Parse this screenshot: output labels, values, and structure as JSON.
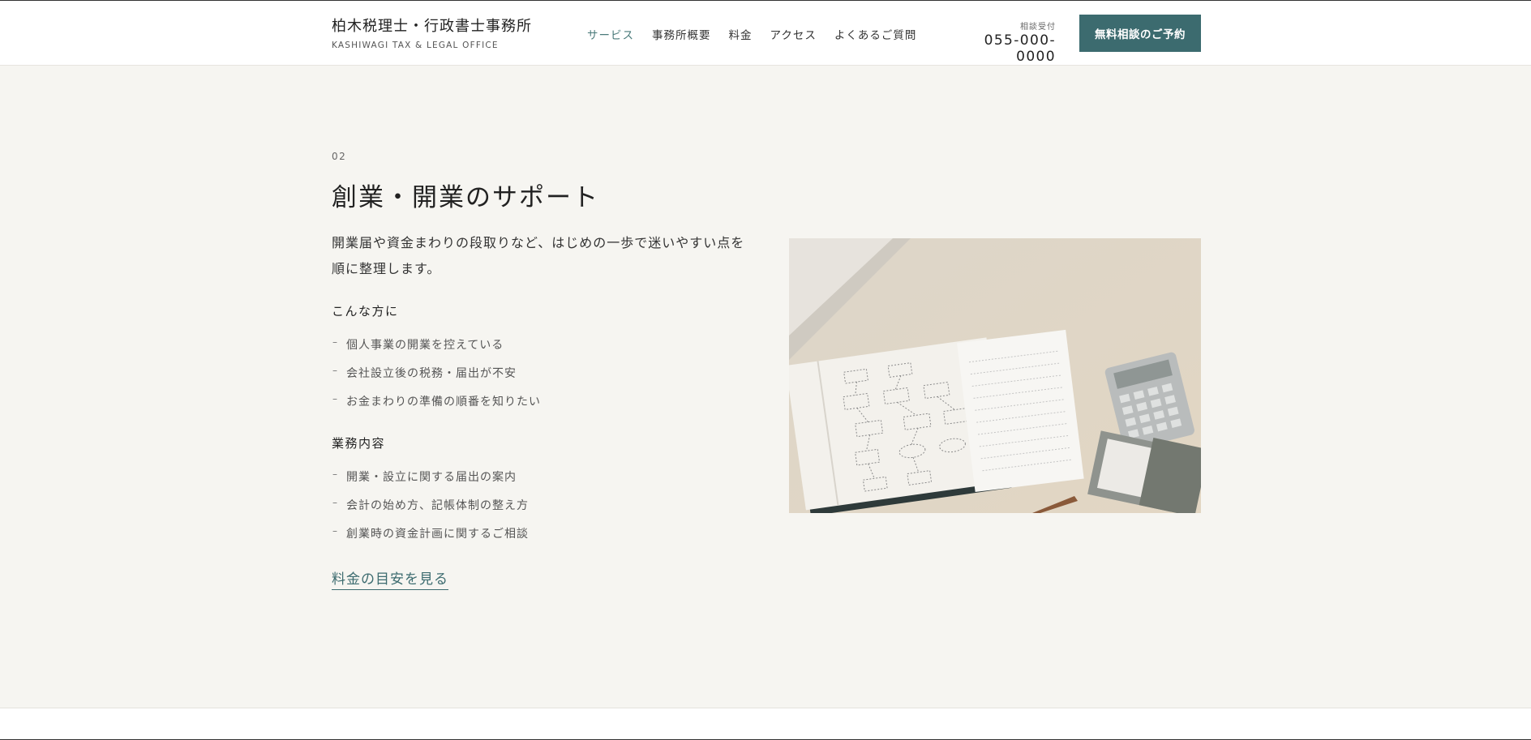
{
  "header": {
    "brand_name": "柏木税理士・行政書士事務所",
    "brand_sub": "KASHIWAGI TAX & LEGAL OFFICE",
    "nav": [
      {
        "label": "サービス",
        "active": true
      },
      {
        "label": "事務所概要"
      },
      {
        "label": "料金"
      },
      {
        "label": "アクセス"
      },
      {
        "label": "よくあるご質問"
      }
    ],
    "phone_label": "相談受付",
    "phone_number": "055-000-0000",
    "cta_label": "無料相談のご予約"
  },
  "section": {
    "number": "02",
    "title": "創業・開業のサポート",
    "lead": "開業届や資金まわりの段取りなど、はじめの一歩で迷いやすい点を順に整理します。",
    "target_heading": "こんな方に",
    "target_items": [
      "個人事業の開業を控えている",
      "会社設立後の税務・届出が不安",
      "お金まわりの準備の順番を知りたい"
    ],
    "services_heading": "業務内容",
    "services_items": [
      "開業・設立に関する届出の案内",
      "会計の始め方、記帳体制の整え方",
      "創業時の資金計画に関するご相談"
    ],
    "link_label": "料金の目安を見る"
  },
  "colors": {
    "accent": "#3c6b6f",
    "background": "#f6f5f1",
    "active_nav": "#4a7a7a"
  }
}
